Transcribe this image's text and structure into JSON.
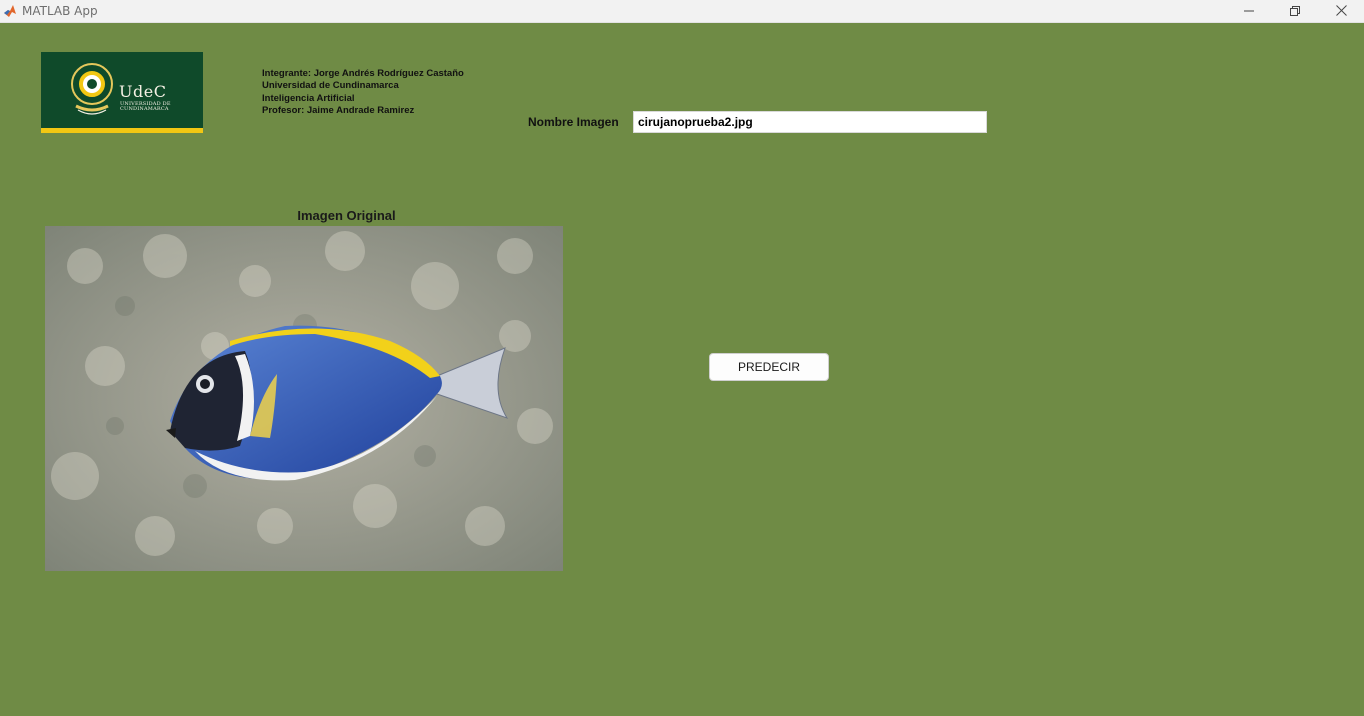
{
  "window": {
    "title": "MATLAB App",
    "icon": "matlab-icon",
    "controls": [
      "minimize-icon",
      "restore-icon",
      "close-icon"
    ]
  },
  "logo": {
    "name": "UdeC",
    "subtitle_line1": "UNIVERSIDAD DE",
    "subtitle_line2": "CUNDINAMARCA",
    "colors": {
      "background": "#0f4a2a",
      "accent": "#f2c713"
    }
  },
  "info": {
    "line1": "Integrante: Jorge Andrés Rodríguez Castaño",
    "line2": "Universidad de Cundinamarca",
    "line3": "Inteligencia Artificial",
    "line4": "Profesor: Jaime Andrade Ramirez"
  },
  "image_name": {
    "label": "Nombre Imagen",
    "value": "cirujanoprueba2.jpg"
  },
  "axes": {
    "title": "Imagen Original"
  },
  "predict_button": {
    "label": "PREDECIR"
  },
  "colors": {
    "background": "#6f8b45",
    "titlebar": "#f2f2f2"
  }
}
